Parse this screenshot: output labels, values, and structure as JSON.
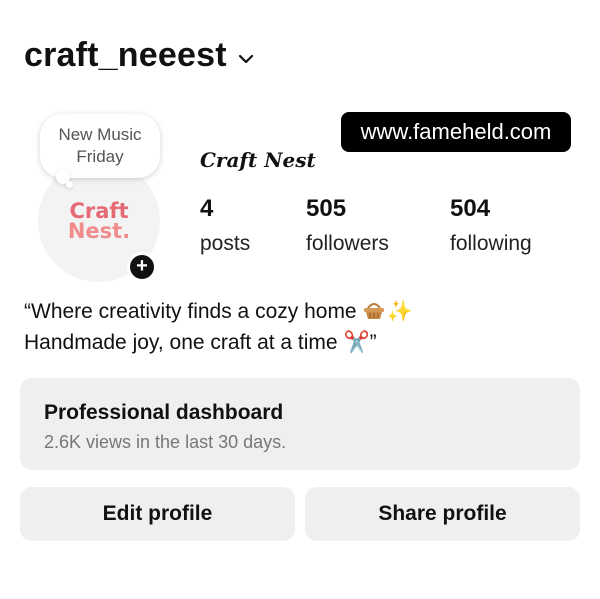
{
  "header": {
    "username": "craft_neeest"
  },
  "watermark": {
    "text": "www.fameheld.com"
  },
  "note": {
    "line1": "New Music",
    "line2": "Friday"
  },
  "avatar": {
    "logo_line1": "Craft",
    "logo_line2": "Nest."
  },
  "profile": {
    "display_name": "Craft Nest"
  },
  "stats": [
    {
      "value": "4",
      "label": "posts"
    },
    {
      "value": "505",
      "label": "followers"
    },
    {
      "value": "504",
      "label": "following"
    }
  ],
  "bio": {
    "line1": "“Where creativity finds a cozy home",
    "line1_emoji2": "✨",
    "line2": "Handmade joy, one craft at a time",
    "line2_emoji": "✂️",
    "line2_end": "”"
  },
  "dashboard": {
    "title": "Professional dashboard",
    "subtitle": "2.6K views in the last 30 days."
  },
  "buttons": {
    "edit": "Edit profile",
    "share": "Share profile"
  },
  "colors": {
    "card_bg": "#efeff1",
    "logo_pink": "#e56a73",
    "text": "#111111",
    "muted": "#777777"
  }
}
